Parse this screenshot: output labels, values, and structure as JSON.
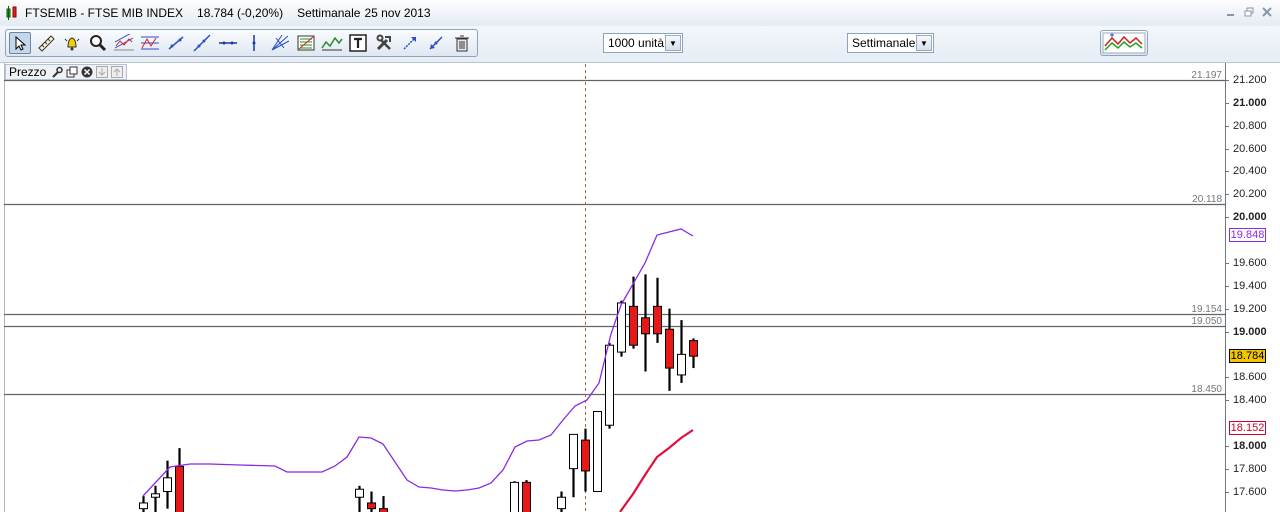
{
  "window": {
    "symbol": "FTSEMIB - FTSE MIB INDEX",
    "quote": "18.784 (-0,20%)",
    "period": "Settimanale",
    "date": "25 nov 2013"
  },
  "toolbar": {
    "tools": [
      "pointer-icon",
      "ruler-icon",
      "alarm-bell-icon",
      "zoom-icon",
      "trend-channel-icon",
      "fibonacci-icon",
      "line-icon",
      "ray-icon",
      "horizontal-line-icon",
      "vertical-line-icon",
      "fan-icon",
      "gann-icon",
      "zigzag-icon",
      "text-icon",
      "tools-icon",
      "arrow-up-icon",
      "arrow-down-icon",
      "trash-icon"
    ],
    "units_combo": "1000 unità",
    "period_combo": "Settimanale"
  },
  "pane": {
    "label": "Prezzo"
  },
  "axis": {
    "ticks": [
      {
        "v": 21.2,
        "label": "21.200",
        "major": false
      },
      {
        "v": 21.0,
        "label": "21.000",
        "major": true
      },
      {
        "v": 20.8,
        "label": "20.800",
        "major": false
      },
      {
        "v": 20.6,
        "label": "20.600",
        "major": false
      },
      {
        "v": 20.4,
        "label": "20.400",
        "major": false
      },
      {
        "v": 20.2,
        "label": "20.200",
        "major": false
      },
      {
        "v": 20.0,
        "label": "20.000",
        "major": true
      },
      {
        "v": 19.6,
        "label": "19.600",
        "major": false
      },
      {
        "v": 19.4,
        "label": "19.400",
        "major": false
      },
      {
        "v": 19.2,
        "label": "19.200",
        "major": false
      },
      {
        "v": 19.0,
        "label": "19.000",
        "major": true
      },
      {
        "v": 18.6,
        "label": "18.600",
        "major": false
      },
      {
        "v": 18.4,
        "label": "18.400",
        "major": false
      },
      {
        "v": 18.0,
        "label": "18.000",
        "major": true
      },
      {
        "v": 17.8,
        "label": "17.800",
        "major": false
      },
      {
        "v": 17.6,
        "label": "17.600",
        "major": false
      }
    ],
    "badges": [
      {
        "v": 19.848,
        "label": "19.848",
        "color": "#8a2be2",
        "bg": "#ffffff"
      },
      {
        "v": 18.784,
        "label": "18.784",
        "color": "#000000",
        "bg": "#f5c400"
      },
      {
        "v": 18.152,
        "label": "18.152",
        "color": "#d0002a",
        "bg": "#ffffff"
      }
    ]
  },
  "levels": [
    {
      "v": 21.197,
      "label": "21.197"
    },
    {
      "v": 20.118,
      "label": "20.118"
    },
    {
      "v": 19.154,
      "label": "19.154"
    },
    {
      "v": 19.05,
      "label": "19.050"
    },
    {
      "v": 18.45,
      "label": "18.450"
    }
  ],
  "chart_data": {
    "type": "candlestick",
    "candles": [
      {
        "o": 17.45,
        "h": 17.56,
        "l": 17.2,
        "c": 17.5
      },
      {
        "o": 17.55,
        "h": 17.65,
        "l": 17.3,
        "c": 17.58
      },
      {
        "o": 17.6,
        "h": 17.87,
        "l": 17.45,
        "c": 17.72
      },
      {
        "o": 17.82,
        "h": 17.98,
        "l": 17.2,
        "c": 17.4
      },
      {
        "o": 17.55,
        "h": 17.65,
        "l": 17.2,
        "c": 17.62
      },
      {
        "o": 17.5,
        "h": 17.6,
        "l": 17.2,
        "c": 17.45
      },
      {
        "o": 17.45,
        "h": 17.56,
        "l": 17.2,
        "c": 17.3
      },
      {
        "o": 17.4,
        "h": 17.69,
        "l": 17.2,
        "c": 17.68
      },
      {
        "o": 17.68,
        "h": 17.7,
        "l": 17.3,
        "c": 17.4
      },
      {
        "o": 17.45,
        "h": 17.6,
        "l": 17.2,
        "c": 17.55
      },
      {
        "o": 17.8,
        "h": 18.1,
        "l": 17.55,
        "c": 18.1
      },
      {
        "o": 18.05,
        "h": 18.15,
        "l": 17.6,
        "c": 17.78
      },
      {
        "o": 17.6,
        "h": 18.3,
        "l": 17.6,
        "c": 18.3
      },
      {
        "o": 18.18,
        "h": 18.9,
        "l": 18.15,
        "c": 18.88
      },
      {
        "o": 18.82,
        "h": 19.27,
        "l": 18.78,
        "c": 19.25
      },
      {
        "o": 19.22,
        "h": 19.48,
        "l": 18.85,
        "c": 18.88
      },
      {
        "o": 19.12,
        "h": 19.5,
        "l": 18.65,
        "c": 18.98
      },
      {
        "o": 19.22,
        "h": 19.47,
        "l": 18.9,
        "c": 18.98
      },
      {
        "o": 19.02,
        "h": 19.2,
        "l": 18.48,
        "c": 18.68
      },
      {
        "o": 18.62,
        "h": 19.1,
        "l": 18.55,
        "c": 18.8
      },
      {
        "o": 18.92,
        "h": 18.94,
        "l": 18.68,
        "c": 18.784
      }
    ],
    "bollinger_upper": [
      17.82,
      17.84,
      17.85,
      17.85,
      17.84,
      17.84,
      17.77,
      17.77,
      17.8,
      17.9,
      18.07,
      18.06,
      17.98,
      17.74,
      17.63,
      17.62,
      17.6,
      17.6,
      17.62,
      17.68,
      17.85,
      17.95,
      17.96,
      18.05,
      18.35,
      18.42,
      18.52,
      18.95,
      19.45,
      19.85,
      19.88,
      19.92,
      19.84
    ],
    "lower_line": [
      17.34,
      17.65,
      17.88,
      17.98,
      18.07,
      18.152
    ]
  }
}
